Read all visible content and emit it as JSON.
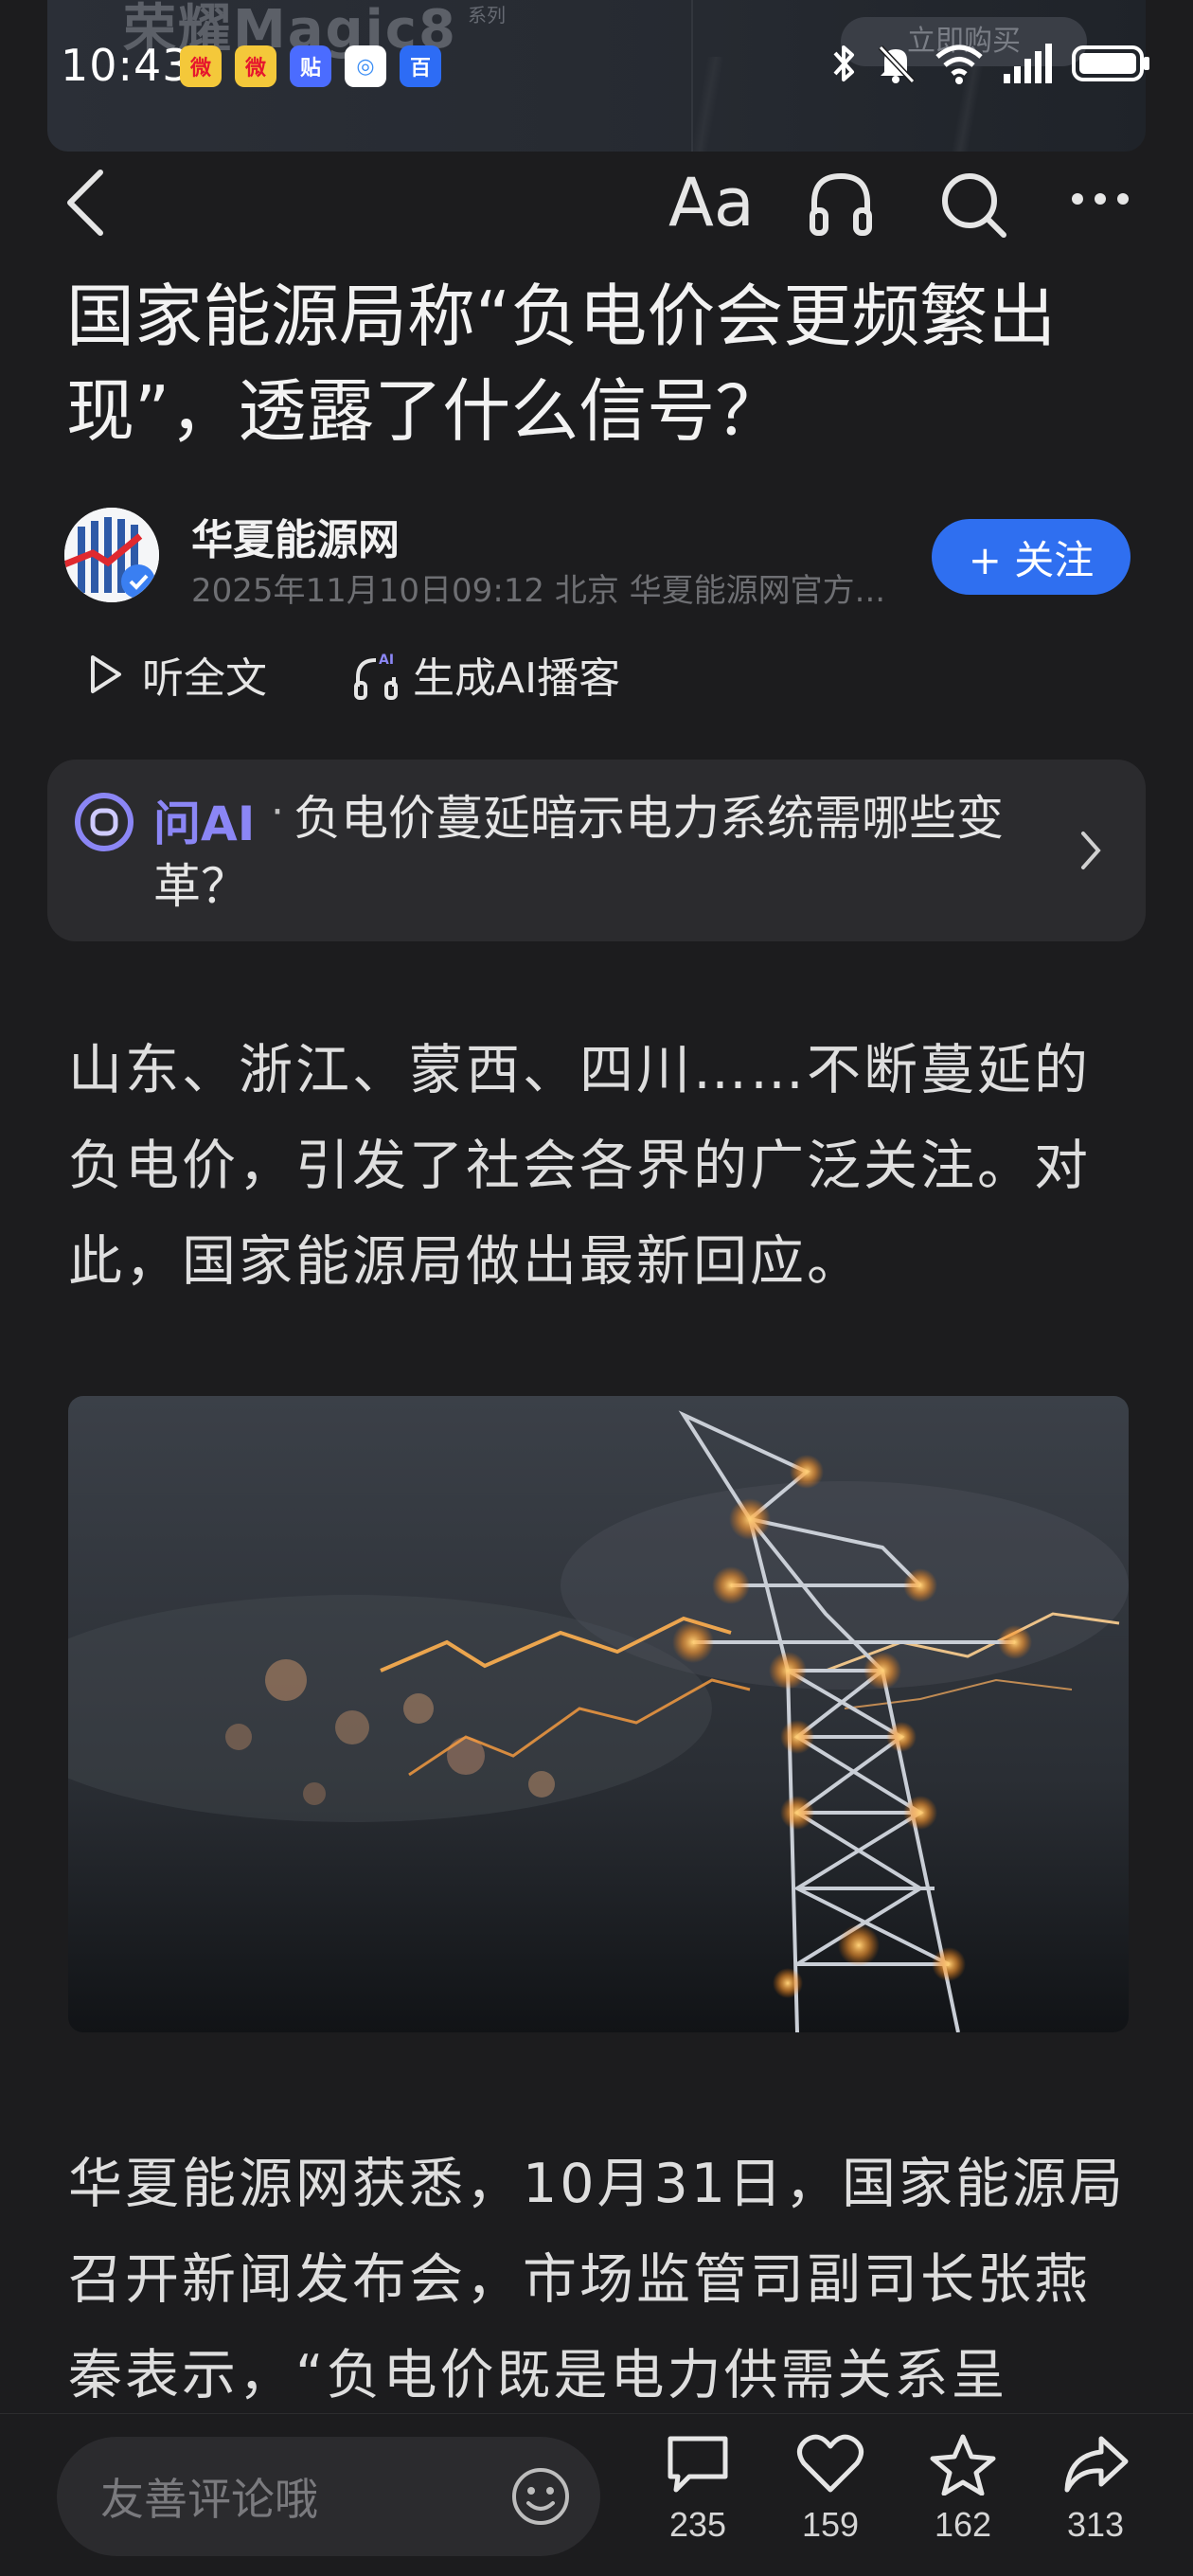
{
  "status_bar": {
    "time": "10:43",
    "apps": [
      {
        "icon": "weibo-icon",
        "color": "#e6162d",
        "glyph": "微"
      },
      {
        "icon": "weibo-icon",
        "color": "#e6162d",
        "glyph": "微"
      },
      {
        "icon": "tieba-icon",
        "color": "#4b6cff",
        "glyph": "贴"
      },
      {
        "icon": "browser-icon",
        "color": "#3a8df5",
        "glyph": "◎"
      },
      {
        "icon": "baidu-icon",
        "color": "#2d6cf5",
        "glyph": "百"
      }
    ],
    "battery_level": 1.0
  },
  "ad": {
    "brand": "荣耀Magic8",
    "series": "系列",
    "cta": "立即购买"
  },
  "nav": {
    "font_label": "Aa"
  },
  "article": {
    "title": "国家能源局称“负电价会更频繁出现”，透露了什么信号？",
    "author": {
      "name": "华夏能源网",
      "meta": "2025年11月10日09:12 北京 华夏能源网官方..."
    },
    "follow_label": "+ 关注",
    "listen_label": "听全文",
    "podcast_label": "生成AI播客",
    "ask_ai": {
      "label": "问AI",
      "separator": "·",
      "question": "负电价蔓延暗示电力系统需哪些变革？"
    },
    "paragraph_1": "山东、浙江、蒙西、四川……不断蔓延的负电价，引发了社会各界的广泛关注。对此，国家能源局做出最新回应。",
    "paragraph_2": "华夏能源网获悉，10月31日，国家能源局召开新闻发布会，市场监管司副司长张燕秦表示，“负电价既是电力供需关系呈"
  },
  "bottom_bar": {
    "comment_placeholder": "友善评论哦",
    "comments": "235",
    "likes": "159",
    "favorites": "162",
    "shares": "313"
  },
  "colors": {
    "background": "#1c1c1e",
    "accent_blue": "#2f6ff0",
    "ai_purple": "#8b86f5"
  }
}
